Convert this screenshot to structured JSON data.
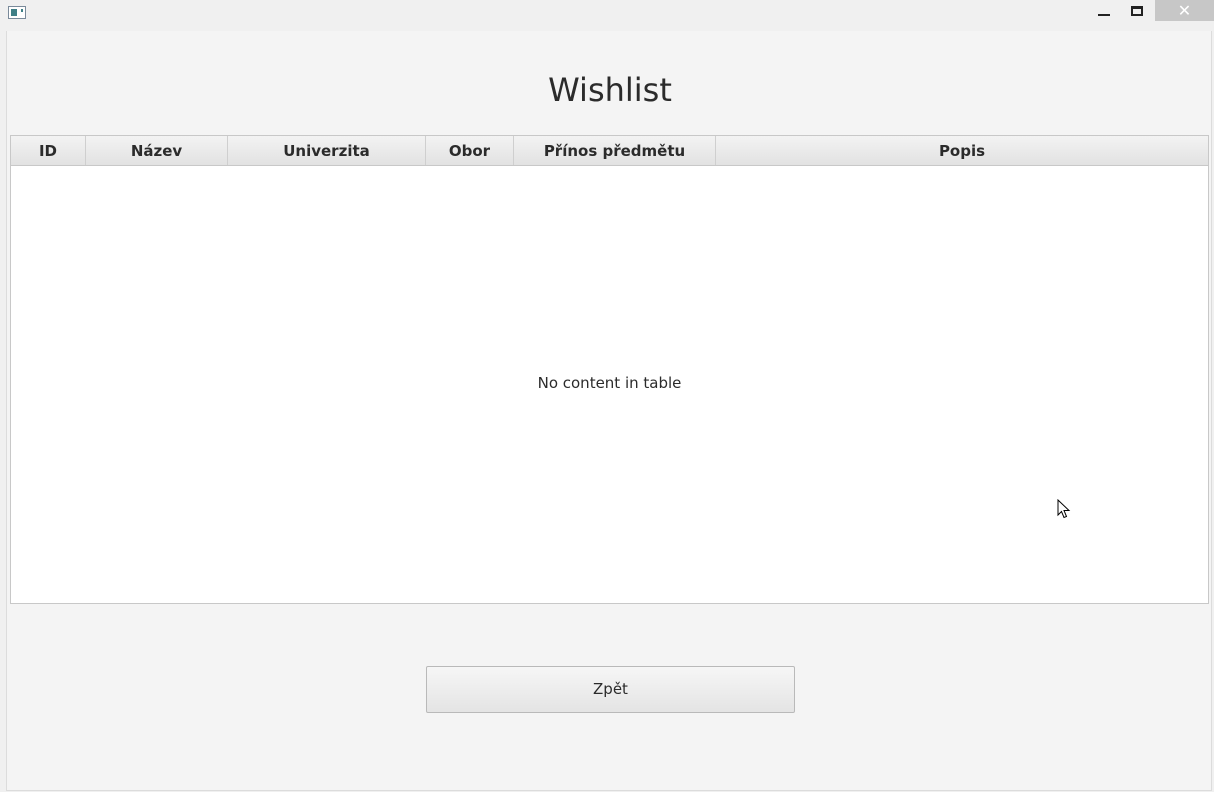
{
  "window": {
    "title": "",
    "controls": {
      "minimize_icon": "minimize-icon",
      "maximize_icon": "maximize-icon",
      "close_glyph": "✕"
    },
    "close_hover_color": "#c7c7c7"
  },
  "page": {
    "heading": "Wishlist"
  },
  "table": {
    "columns": [
      "ID",
      "Název",
      "Univerzita",
      "Obor",
      "Přínos předmětu",
      "Popis"
    ],
    "rows": [],
    "placeholder": "No content in table"
  },
  "actions": {
    "back_label": "Zpět"
  },
  "colors": {
    "background": "#f4f4f4",
    "table_header": "#e8e8e8",
    "text": "#2b2b2b"
  }
}
